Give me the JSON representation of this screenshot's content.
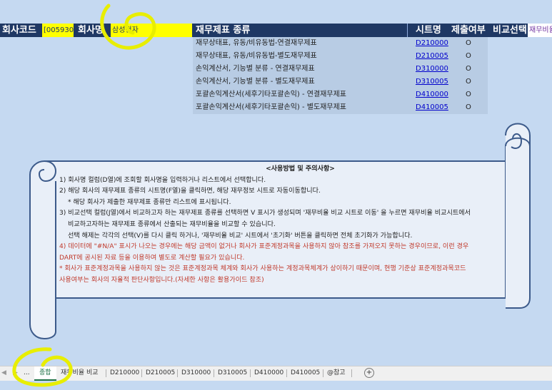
{
  "header": {
    "company_code_label": "회사코드",
    "company_code_value": "[005930]",
    "company_name_label": "회사명",
    "company_name_value": "삼성전자",
    "statement_type_label": "재무제표 종류",
    "sheet_name_label": "시트명",
    "submitted_label": "제출여부",
    "compare_label": "비교선택",
    "compare_link": "재무비율"
  },
  "rows": [
    {
      "name": "재무상태표, 유동/비유동법-연결재무제표",
      "sheet": "D210000",
      "submitted": "O"
    },
    {
      "name": "재무상태표, 유동/비유동법-별도재무제표",
      "sheet": "D210005",
      "submitted": "O"
    },
    {
      "name": "손익계산서, 기능별 분류 - 연결재무제표",
      "sheet": "D310000",
      "submitted": "O"
    },
    {
      "name": "손익계산서, 기능별 분류 - 별도재무제표",
      "sheet": "D310005",
      "submitted": "O"
    },
    {
      "name": "포괄손익계산서(세후기타포괄손익) - 연결재무제표",
      "sheet": "D410000",
      "submitted": "O"
    },
    {
      "name": "포괄손익계산서(세후기타포괄손익) - 별도재무제표",
      "sheet": "D410005",
      "submitted": "O"
    }
  ],
  "notes": {
    "title": "<사용방법 및 주의사항>",
    "l1": "1) 회사명 컬럼(D열)에 조회할 회사명을 입력하거나 리스트에서 선택합니다.",
    "l2": "2) 해당 회사의 재무제표 종류의 시트명(F열)을 클릭하면, 해당 재무정보 시트로 자동이동합니다.",
    "l3": "* 해당 회사가 제출한 재무제표 종류만 리스트에 표시됩니다.",
    "l4": "3) 비교선택 컬럼(J열)에서 비교하고자 하는 재무제표 종류를 선택하면 V 표시가 생성되며 '재무비율 비교 시트로 이동' 을 누르면 재무비율 비교시트에서",
    "l5": "비교하고자하는 재무제표 종류에서 산출되는 재무비율을 비교할 수 있습니다.",
    "l6": "선택 해제는 각각의 선택(V)를 다시 클릭 하거나, '재무비율 비교' 시트에서 '초기화' 버튼을 클릭하면 전체  초기화가  가능합니다.",
    "l7": "4) 데이터에 \"#N/A\" 표시가 나오는 경우에는 해당 금액이 없거나 회사가 표준계정과목을 사용하지 않아 참조를 가져오지 못하는 경우이므로, 이런 경우",
    "l8": "DART에 공시된 자료 등을 이용하여 별도로 계산할 필요가 있습니다.",
    "l9": "* 회사가 표준계정과목을 사용하지 않는 것은 표준계정과목 체계와 회사가 사용하는 계정과목체계가 상이하기 때문이며, 현행 기준상 표준계정과목코드",
    "l10": "사용여부는 회사의 자율적 판단사항입니다.(자세한 사항은 활용가이드 참조)"
  },
  "tabs": {
    "more": "...",
    "active": "종합",
    "items": [
      "재무비율 비교",
      "D210000",
      "D210005",
      "D310000",
      "D310005",
      "D410000",
      "D410005",
      "@참고"
    ],
    "add": "+"
  }
}
